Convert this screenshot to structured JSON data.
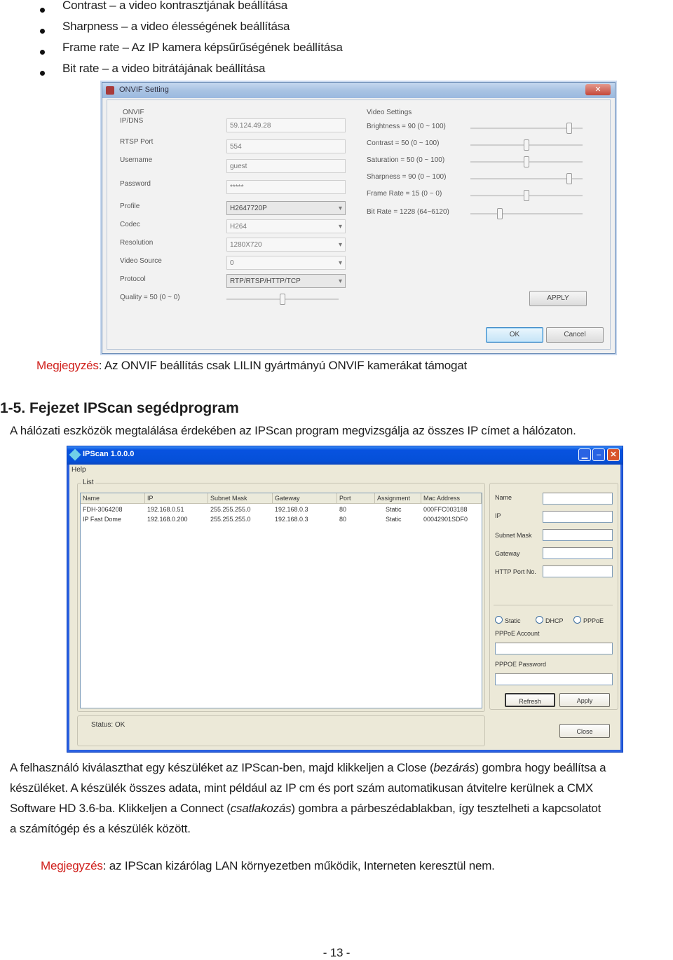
{
  "bullets": [
    "Contrast – a video kontrasztjának beállítása",
    "Sharpness – a video élességének beállítása",
    "Frame rate – Az IP kamera képsűrűségének beállítása",
    "Bit rate – a video bitrátájának beállítása"
  ],
  "onvif_window": {
    "title": "ONVIF Setting",
    "close_label": "✕",
    "section_label": "ONVIF",
    "fields": [
      {
        "label": "IP/DNS",
        "value": "59.124.49.28"
      },
      {
        "label": "RTSP Port",
        "value": "554"
      },
      {
        "label": "Username",
        "value": "guest"
      },
      {
        "label": "Password",
        "value": "*****"
      }
    ],
    "dropdowns": [
      {
        "label": "Profile",
        "value": "H2647720P"
      },
      {
        "label": "Codec",
        "value": "H264"
      },
      {
        "label": "Resolution",
        "value": "1280X720"
      },
      {
        "label": "Video Source",
        "value": "0"
      },
      {
        "label": "Protocol",
        "value": "RTP/RTSP/HTTP/TCP"
      }
    ],
    "quality": {
      "label": "Quality = 50 (0 ~ 0)",
      "value": 50,
      "fraction": 0.5
    },
    "video_settings_label": "Video Settings",
    "sliders": [
      {
        "label": "Brightness = 90 (0 ~ 100)",
        "fraction": 0.9
      },
      {
        "label": "Contrast = 50 (0 ~ 100)",
        "fraction": 0.5
      },
      {
        "label": "Saturation = 50 (0 ~ 100)",
        "fraction": 0.5
      },
      {
        "label": "Sharpness = 90 (0 ~ 100)",
        "fraction": 0.9
      },
      {
        "label": "Frame Rate = 15 (0 ~ 0)",
        "fraction": 0.5
      },
      {
        "label": "Bit Rate = 1228 (64~6120)",
        "fraction": 0.25
      }
    ],
    "apply_label": "APPLY",
    "ok_label": "OK",
    "cancel_label": "Cancel"
  },
  "note1": {
    "prefix": "Megjegyzés",
    "text": ": Az ONVIF beállítás csak LILIN gyártmányú ONVIF kamerákat támogat"
  },
  "heading": "1-5.  Fejezet IPScan segédprogram",
  "intro": "A hálózati eszközök megtalálása érdekében az IPScan program megvizsgálja az összes IP címet a hálózaton.",
  "ipscan_window": {
    "title": "IPScan 1.0.0.0",
    "menu": "Help",
    "list_label": "List",
    "columns": [
      "Name",
      "IP",
      "Subnet Mask",
      "Gateway",
      "Port",
      "Assignment",
      "Mac Address"
    ],
    "rows": [
      [
        "FDH-3064208",
        "192.168.0.51",
        "255.255.255.0",
        "192.168.0.3",
        "80",
        "Static",
        "000FFC003188"
      ],
      [
        "IP Fast Dome",
        "192.168.0.200",
        "255.255.255.0",
        "192.168.0.3",
        "80",
        "Static",
        "00042901SDF0"
      ]
    ],
    "status": "Status:  OK",
    "right_panel": {
      "name_label": "Name",
      "ip_label": "IP",
      "subnet_label": "Subnet Mask",
      "gateway_label": "Gateway",
      "http_port_label": "HTTP Port No.",
      "radio_static": "Static",
      "radio_dhcp": "DHCP",
      "radio_pppoe": "PPPoE",
      "pppoe_account_label": "PPPoE Account",
      "pppoe_password_label": "PPPOE Password",
      "refresh_label": "Refresh",
      "apply_label": "Apply",
      "close_label": "Close"
    }
  },
  "paragraph": {
    "l1a": "A felhasználó kiválaszthat egy készüléket az IPScan-ben, majd klikkeljen a Close (",
    "l1i": "bezárás",
    "l1b": ") gombra hogy beállítsa a",
    "l2": "készüléket. A készülék összes adata, mint például az IP cm és port szám automatikusan átvitelre kerülnek a CMX",
    "l3a": "Software HD 3.6-ba. Klikkeljen a Connect (",
    "l3i": "csatlakozás",
    "l3b": ") gombra a párbeszédablakban, így tesztelheti a kapcsolatot",
    "l4": "a számítógép és a készülék között."
  },
  "note2": {
    "prefix": "Megjegyzés",
    "text": ": az IPScan kizárólag LAN környezetben működik, Interneten keresztül nem."
  },
  "page_number": "- 13 -",
  "colors": {
    "note_red": "#d0201c",
    "xp_blue": "#0853e0"
  }
}
